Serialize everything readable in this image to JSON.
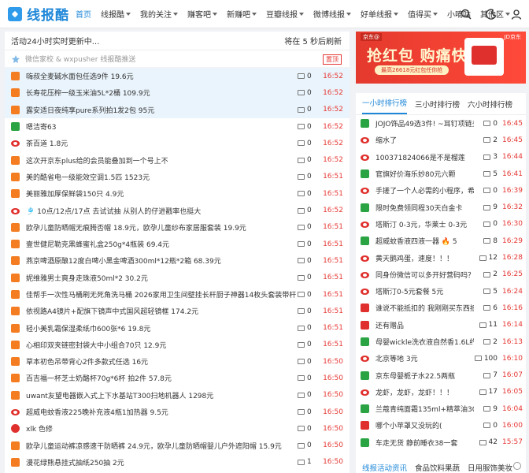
{
  "nav": {
    "logo": "线报酷",
    "menu": [
      {
        "label": "首页",
        "active": true,
        "caret": false
      },
      {
        "label": "线报酷",
        "caret": true
      },
      {
        "label": "我的关注",
        "caret": true
      },
      {
        "label": "赚客吧",
        "caret": true
      },
      {
        "label": "新赚吧",
        "caret": true
      },
      {
        "label": "豆瓣线报",
        "caret": true
      },
      {
        "label": "微博线报",
        "caret": true
      },
      {
        "label": "好单线报",
        "caret": true
      },
      {
        "label": "值得买",
        "caret": true
      },
      {
        "label": "小嘀咕",
        "caret": false
      },
      {
        "label": "其他区",
        "caret": true
      }
    ],
    "icons": [
      "search-icon",
      "dark-mode-moon-icon",
      "user-avatar-icon"
    ]
  },
  "feed": {
    "header_left": "活动24小时实时更新中...",
    "header_right": "将在 5 秒后刷新",
    "wx_text": "微信家校 & wxpusher 线报酷推送",
    "wx_button": "置顶",
    "items": [
      {
        "src": "tb",
        "title": "嗨叔全麦碱水面包任选9件 19.6元",
        "count": "0",
        "time": "16:52",
        "hl": true
      },
      {
        "src": "tb",
        "title": "长寿花压榨一级玉米油5L*2桶 109.9元",
        "count": "0",
        "time": "16:52",
        "hl": true
      },
      {
        "src": "tb",
        "title": "露安适日夜纯享pure系列拍1发2包 95元",
        "count": "0",
        "time": "16:52",
        "hl": true
      },
      {
        "src": "pdd",
        "title": "嗯洁寄63",
        "count": "0",
        "time": "16:52"
      },
      {
        "src": "wb",
        "title": "茶百道 1.8元",
        "count": "0",
        "time": "16:52"
      },
      {
        "src": "tb",
        "title": "这次开京东plus给的会员能叠加到一个号上不",
        "count": "0",
        "time": "16:52"
      },
      {
        "src": "tb",
        "title": "美的酷省电一级能效空调1.5匹 1523元",
        "count": "0",
        "time": "16:51"
      },
      {
        "src": "tb",
        "title": "美丽雅加厚保鲜袋150只 4.9元",
        "count": "0",
        "time": "16:51"
      },
      {
        "src": "wb",
        "title": "🎐 10点/12点/17点 去试试抽 从别人的仔进戳率也挺大",
        "count": "0",
        "time": "16:52"
      },
      {
        "src": "tb",
        "title": "欧孕儿童防晒帽无痕腾否帽 18.9元，欧孕儿童纱布家居服套装 19.9元",
        "count": "0",
        "time": "16:51"
      },
      {
        "src": "tb",
        "title": "壹世健尼勒克黑蜂蜜礼盒250g*4瓶装 69.4元",
        "count": "0",
        "time": "16:51"
      },
      {
        "src": "tb",
        "title": "燕京啤酒原酿12度白啤小黑金啤酒300ml*12瓶*2箱 68.39元",
        "count": "0",
        "time": "16:51"
      },
      {
        "src": "tb",
        "title": "妮维雅男士爽身走珠液50ml*2 30.2元",
        "count": "0",
        "time": "16:51"
      },
      {
        "src": "tb",
        "title": "佳帮手一次性马桶刷无死角洗马桶 2026家用卫生间壁挂长杆厨子神器14枚头套装带杆 14.12元",
        "count": "0",
        "time": "16:51"
      },
      {
        "src": "tb",
        "title": "依视路A4镜片+配旗下镜声中式国风超轻镜框 174.2元",
        "count": "0",
        "time": "16:51"
      },
      {
        "src": "tb",
        "title": "轻小美乳霜保湿柔纸巾600张*6 19.8元",
        "count": "0",
        "time": "16:51"
      },
      {
        "src": "tb",
        "title": "心相印双夹链密封袋大中小组合70只 12.9元",
        "count": "0",
        "time": "16:51"
      },
      {
        "src": "tb",
        "title": "草本初色吊带背心2件多款式任选 16元",
        "count": "0",
        "time": "16:50"
      },
      {
        "src": "tb",
        "title": "百吉福一杯芝士奶酪杯70g*6杯 拍2件 57.8元",
        "count": "0",
        "time": "16:50"
      },
      {
        "src": "tb",
        "title": "uwant友望电器嵌入式上下水基站T300扫地机器人 1298元",
        "count": "0",
        "time": "16:50"
      },
      {
        "src": "wb",
        "title": "超威电蚊香液225晚补充液4瓶1加热器 9.5元",
        "count": "0",
        "time": "16:50"
      },
      {
        "src": "zd",
        "title": "xlk 色修",
        "count": "0",
        "time": "16:50"
      },
      {
        "src": "tb",
        "title": "欧孕儿童运动裤凉感速干防晒裤 24.9元，欧孕儿童防晒帽婴儿户外遮阳帽 15.9元",
        "count": "0",
        "time": "16:50"
      },
      {
        "src": "tb",
        "title": "漫花绿熊悬挂式抽纸250抽 2元",
        "count": "1",
        "time": "16:50"
      }
    ]
  },
  "banner": {
    "tag": "京东@",
    "title": "抢红包 购痛快!",
    "sub": "最高26618元红包任你抢",
    "logo": "JD京东"
  },
  "rank": {
    "tabs": [
      "一小时排行榜",
      "三小时排行榜",
      "六小时排行榜"
    ],
    "items": [
      {
        "src": "pdd",
        "title": "JOJO饰品49选3件! ~耳钉项链头饰",
        "count": "0",
        "time": "16:45"
      },
      {
        "src": "wb",
        "title": "缩水了",
        "count": "2",
        "time": "16:45"
      },
      {
        "src": "wb",
        "title": "100371824066是不是榴莲",
        "count": "3",
        "time": "16:44"
      },
      {
        "src": "pdd",
        "title": "官旗好价海乐妙80元六颗",
        "count": "5",
        "time": "16:41"
      },
      {
        "src": "wb",
        "title": "手搓了一个人必需的小程序，希...",
        "count": "0",
        "time": "16:39"
      },
      {
        "src": "pdd",
        "title": "限时免费领同程30天白金卡",
        "count": "9",
        "time": "16:32"
      },
      {
        "src": "wb",
        "title": "塔斯汀 0-3元，华莱士 0-3元",
        "count": "0",
        "time": "16:30"
      },
      {
        "src": "pdd",
        "title": "超威蚊香液四液一器 🔥 5",
        "count": "8",
        "time": "16:29"
      },
      {
        "src": "wb",
        "title": "黄天鹅鸡蛋，速度！！！",
        "count": "12",
        "time": "16:28"
      },
      {
        "src": "wb",
        "title": "同身份微信可以多开好营码吗？兄...",
        "count": "2",
        "time": "16:25"
      },
      {
        "src": "wb",
        "title": "塔斯汀0-5元套餐 5元",
        "count": "5",
        "time": "16:24"
      },
      {
        "src": "sm",
        "title": "谁说不能抵扣的 我刚刚买东西抵扣了",
        "count": "6",
        "time": "16:16"
      },
      {
        "src": "zd",
        "title": "还有赠品",
        "count": "11",
        "time": "16:14"
      },
      {
        "src": "pdd",
        "title": "母婴wickle洗衣液自然香1.6L约23...",
        "count": "2",
        "time": "16:13"
      },
      {
        "src": "wb",
        "title": "北京等地 3元",
        "count": "100",
        "time": "16:10"
      },
      {
        "src": "pdd",
        "title": "京东母婴栀子水22.5两瓶",
        "count": "7",
        "time": "16:07"
      },
      {
        "src": "wb",
        "title": "龙虾，龙虾，龙虾！！！",
        "count": "17",
        "time": "16:05"
      },
      {
        "src": "pdd",
        "title": "兰蔻青纯面霜135ml+精萃油30ml ...",
        "count": "9",
        "time": "16:04"
      },
      {
        "src": "sm",
        "title": "哪个小苹罩又没玩的(",
        "count": "0",
        "time": "16:00"
      },
      {
        "src": "pdd",
        "title": "车走无货 静前睡衣38一套",
        "count": "42",
        "time": "15:57"
      }
    ]
  },
  "bottom_tabs": [
    "线报活动资讯",
    "食品饮料果蔬",
    "日用服饰美妆"
  ],
  "colors": {
    "accent": "#1e87d8",
    "time_red": "#e53935",
    "highlight": "#eaf4fc"
  }
}
